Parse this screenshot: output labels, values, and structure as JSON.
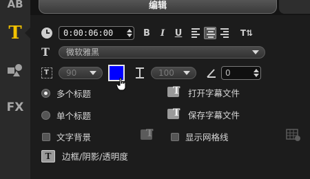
{
  "sidebar": {
    "items": [
      "AB",
      "T",
      "FX"
    ]
  },
  "tab": {
    "title": "编辑"
  },
  "timecode": {
    "value": "0:00:06:00"
  },
  "format": {
    "bold": "B",
    "italic": "I",
    "underline": "U",
    "text_direction": "T⇅"
  },
  "font": {
    "family": "微软雅黑"
  },
  "size": {
    "value": "90"
  },
  "color": {
    "text": "#0000ff"
  },
  "line_spacing": {
    "value": "100"
  },
  "angle": {
    "value": "0"
  },
  "titles": {
    "multiple": "多个标题",
    "single": "单个标题"
  },
  "subtitle_file": {
    "open": "打开字幕文件",
    "save": "保存字幕文件"
  },
  "options": {
    "text_background": "文字背景",
    "show_grid": "显示网格线"
  },
  "border": {
    "label": "边框/阴影/透明度"
  }
}
